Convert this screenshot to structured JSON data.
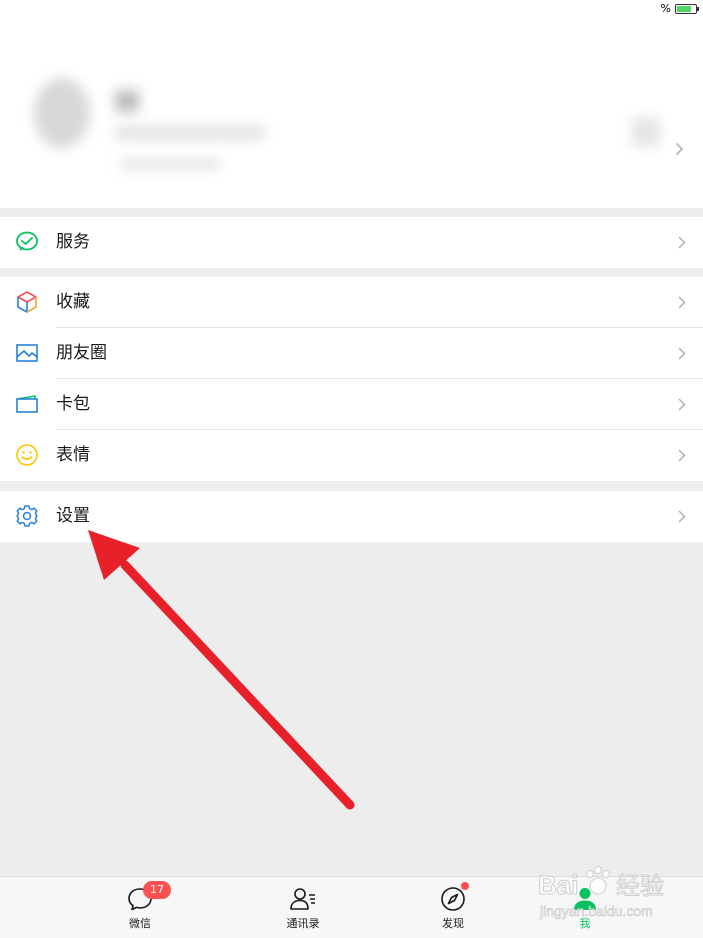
{
  "status_bar": {
    "battery_percent_symbol": "%",
    "battery_color": "#4cd964"
  },
  "profile": {
    "blurred": true,
    "chevron_icon": "chevron-right-icon"
  },
  "groups": [
    {
      "items": [
        {
          "label": "服务",
          "icon": "wechat-pay-icon",
          "icon_color": "#07c160"
        }
      ]
    },
    {
      "items": [
        {
          "label": "收藏",
          "icon": "cube-icon",
          "icon_color": "#fa9d3b"
        },
        {
          "label": "朋友圈",
          "icon": "photo-icon",
          "icon_color": "#2782d7"
        },
        {
          "label": "卡包",
          "icon": "wallet-icon",
          "icon_color": "#2782d7"
        },
        {
          "label": "表情",
          "icon": "smiley-icon",
          "icon_color": "#ffc300"
        }
      ]
    },
    {
      "items": [
        {
          "label": "设置",
          "icon": "gear-icon",
          "icon_color": "#2782d7"
        }
      ]
    }
  ],
  "tabbar": {
    "tabs": [
      {
        "label": "微信",
        "icon": "chat-bubble-icon",
        "badge": "17"
      },
      {
        "label": "通讯录",
        "icon": "contacts-icon"
      },
      {
        "label": "发现",
        "icon": "compass-icon",
        "dot": true
      },
      {
        "label": "我",
        "icon": "person-icon",
        "active": true
      }
    ],
    "active_color": "#07c160",
    "badge_color": "#fa5151"
  },
  "annotation": {
    "arrow_color": "#e8202a",
    "points_to": "设置"
  },
  "watermark": {
    "brand": "Bai",
    "brand_suffix": "经验",
    "url": "jingyan.baidu.com"
  }
}
